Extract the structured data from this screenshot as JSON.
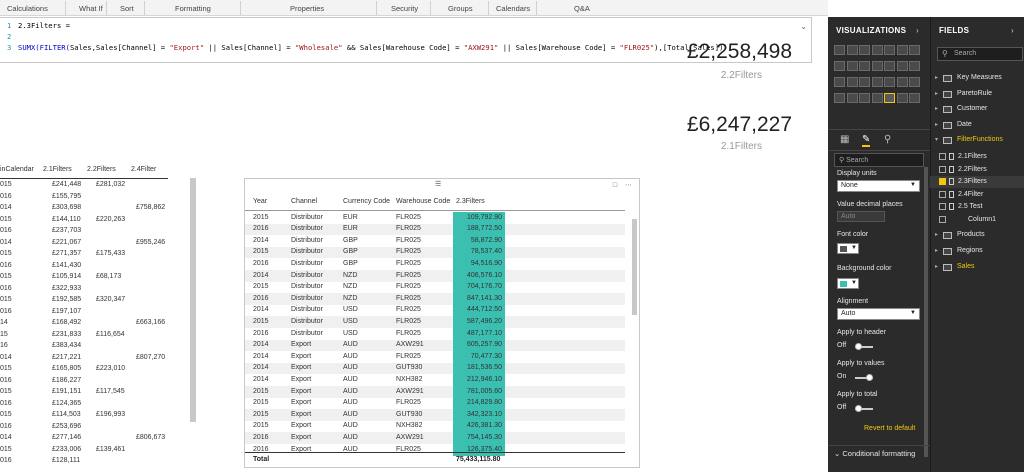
{
  "ribbon": {
    "groups": [
      "Calculations",
      "What If",
      "Sort",
      "Formatting",
      "Properties",
      "Security",
      "Groups",
      "Calendars",
      "Q&A"
    ]
  },
  "formula": {
    "line_numbers": [
      "1",
      "2",
      "3"
    ],
    "line1": "2.3Filters =",
    "line3_fn": "SUMX(FILTER(",
    "line3_a": "Sales,Sales[Channel] = ",
    "line3_s1": "\"Export\"",
    "line3_b": " || Sales[Channel] = ",
    "line3_s2": "\"Wholesale\"",
    "line3_c": " && Sales[Warehouse Code] = ",
    "line3_s3": "\"AXW291\"",
    "line3_d": " || Sales[Warehouse Code] = ",
    "line3_s4": "\"FLR025\"",
    "line3_e": "),[Total Sales])",
    "expand_icon": "chevron-down"
  },
  "cards": [
    {
      "value": "£2,258,498",
      "label": "2.2Filters"
    },
    {
      "value": "£6,247,227",
      "label": "2.1Filters"
    }
  ],
  "left_matrix": {
    "headers": [
      "inCalendar",
      "2.1Filters",
      "2.2Filters",
      "2.4Filter"
    ],
    "rows": [
      [
        "015",
        "£241,448",
        "£281,032",
        ""
      ],
      [
        "016",
        "£155,795",
        "",
        ""
      ],
      [
        "014",
        "£303,698",
        "",
        "£758,862"
      ],
      [
        "015",
        "£144,110",
        "£220,263",
        ""
      ],
      [
        "016",
        "£237,703",
        "",
        ""
      ],
      [
        "014",
        "£221,067",
        "",
        "£955,246"
      ],
      [
        "015",
        "£271,357",
        "£175,433",
        ""
      ],
      [
        "016",
        "£141,430",
        "",
        ""
      ],
      [
        "015",
        "£105,914",
        "£68,173",
        ""
      ],
      [
        "016",
        "£322,933",
        "",
        ""
      ],
      [
        "015",
        "£192,585",
        "£320,347",
        ""
      ],
      [
        "016",
        "£197,107",
        "",
        ""
      ],
      [
        "14",
        "£168,492",
        "",
        "£663,166"
      ],
      [
        "15",
        "£231,833",
        "£116,654",
        ""
      ],
      [
        "16",
        "£383,434",
        "",
        ""
      ],
      [
        "014",
        "£217,221",
        "",
        "£807,270"
      ],
      [
        "015",
        "£165,805",
        "£223,010",
        ""
      ],
      [
        "016",
        "£186,227",
        "",
        ""
      ],
      [
        "015",
        "£191,151",
        "£117,545",
        ""
      ],
      [
        "016",
        "£124,365",
        "",
        ""
      ],
      [
        "015",
        "£114,503",
        "£196,993",
        ""
      ],
      [
        "016",
        "£253,696",
        "",
        ""
      ],
      [
        "014",
        "£277,146",
        "",
        "£806,673"
      ],
      [
        "015",
        "£233,006",
        "£139,461",
        ""
      ],
      [
        "016",
        "£128,111",
        "",
        ""
      ]
    ]
  },
  "table": {
    "headers": [
      "Year",
      "Channel",
      "Currency Code",
      "Warehouse Code",
      "2.3Filters"
    ],
    "rows": [
      [
        "2015",
        "Distributor",
        "EUR",
        "FLR025",
        "109,792.90"
      ],
      [
        "2016",
        "Distributor",
        "EUR",
        "FLR025",
        "188,772.50"
      ],
      [
        "2014",
        "Distributor",
        "GBP",
        "FLR025",
        "58,872.90"
      ],
      [
        "2015",
        "Distributor",
        "GBP",
        "FLR025",
        "78,537.40"
      ],
      [
        "2016",
        "Distributor",
        "GBP",
        "FLR025",
        "94,516.90"
      ],
      [
        "2014",
        "Distributor",
        "NZD",
        "FLR025",
        "406,576.10"
      ],
      [
        "2015",
        "Distributor",
        "NZD",
        "FLR025",
        "704,176.70"
      ],
      [
        "2016",
        "Distributor",
        "NZD",
        "FLR025",
        "847,141.30"
      ],
      [
        "2014",
        "Distributor",
        "USD",
        "FLR025",
        "444,712.50"
      ],
      [
        "2015",
        "Distributor",
        "USD",
        "FLR025",
        "587,496.20"
      ],
      [
        "2016",
        "Distributor",
        "USD",
        "FLR025",
        "487,177.10"
      ],
      [
        "2014",
        "Export",
        "AUD",
        "AXW291",
        "605,257.90"
      ],
      [
        "2014",
        "Export",
        "AUD",
        "FLR025",
        "70,477.30"
      ],
      [
        "2014",
        "Export",
        "AUD",
        "GUT930",
        "181,536.50"
      ],
      [
        "2014",
        "Export",
        "AUD",
        "NXH382",
        "212,946.10"
      ],
      [
        "2015",
        "Export",
        "AUD",
        "AXW291",
        "781,005.60"
      ],
      [
        "2015",
        "Export",
        "AUD",
        "FLR025",
        "214,829.80"
      ],
      [
        "2015",
        "Export",
        "AUD",
        "GUT930",
        "342,323.10"
      ],
      [
        "2015",
        "Export",
        "AUD",
        "NXH382",
        "426,381.30"
      ],
      [
        "2016",
        "Export",
        "AUD",
        "AXW291",
        "754,145.30"
      ],
      [
        "2016",
        "Export",
        "AUD",
        "FLR025",
        "126,375.40"
      ]
    ],
    "total_label": "Total",
    "total_value": "75,433,115.80",
    "value_color": "#3bbfb1"
  },
  "viz_pane": {
    "title": "VISUALIZATIONS",
    "search_placeholder": "Search",
    "display_units_label": "Display units",
    "display_units_value": "None",
    "decimal_label": "Value decimal places",
    "decimal_value": "Auto",
    "font_color_label": "Font color",
    "font_color": "#555555",
    "bg_color_label": "Background color",
    "bg_color": "#3bbfb1",
    "alignment_label": "Alignment",
    "alignment_value": "Auto",
    "apply_header_label": "Apply to header",
    "apply_header_state": "Off",
    "apply_values_label": "Apply to values",
    "apply_values_state": "On",
    "apply_total_label": "Apply to total",
    "apply_total_state": "Off",
    "revert_label": "Revert to default",
    "conditional_label": "Conditional formatting"
  },
  "fields_pane": {
    "title": "FIELDS",
    "search_placeholder": "Search",
    "tables": [
      "Key Measures",
      "ParetoRule",
      "Customer",
      "Date",
      "FilterFunctions"
    ],
    "filter_fields": [
      {
        "label": "2.1Filters",
        "checked": false,
        "calc": true
      },
      {
        "label": "2.2Filters",
        "checked": false,
        "calc": true
      },
      {
        "label": "2.3Filters",
        "checked": true,
        "calc": true
      },
      {
        "label": "2.4Filter",
        "checked": false,
        "calc": true
      },
      {
        "label": "2.5 Test",
        "checked": false,
        "calc": true
      },
      {
        "label": "Column1",
        "checked": false,
        "calc": false
      }
    ],
    "tables_after": [
      "Products",
      "Regions",
      "Sales"
    ]
  }
}
